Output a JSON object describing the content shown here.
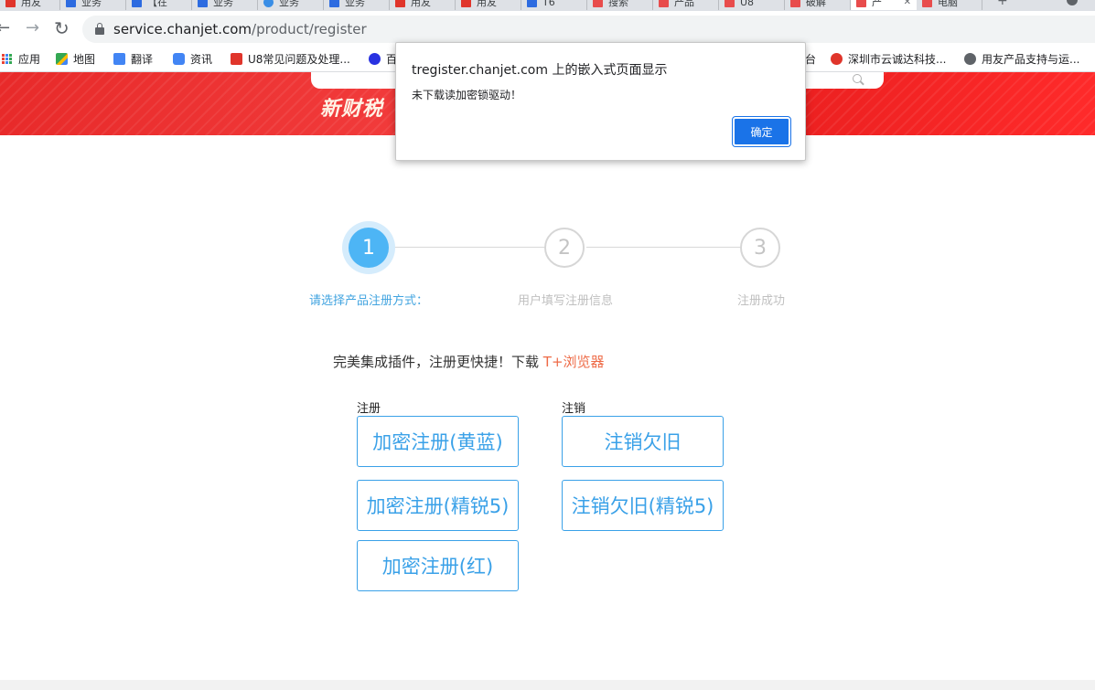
{
  "browser": {
    "tabs": [
      {
        "label": "用友",
        "icon_color": "#e0352b"
      },
      {
        "label": "业务",
        "icon_color": "#2d6be0"
      },
      {
        "label": "【在",
        "icon_color": "#2d6be0"
      },
      {
        "label": "业务",
        "icon_color": "#2d6be0"
      },
      {
        "label": "业务",
        "icon_color": "#3a8ee6"
      },
      {
        "label": "业务",
        "icon_color": "#2d6be0"
      },
      {
        "label": "用友",
        "icon_color": "#e0352b"
      },
      {
        "label": "用友",
        "icon_color": "#e0352b"
      },
      {
        "label": "T6",
        "icon_color": "#2d6be0"
      },
      {
        "label": "搜索",
        "icon_color": "#e84c4c"
      },
      {
        "label": "产品",
        "icon_color": "#e84c4c"
      },
      {
        "label": "U8",
        "icon_color": "#e84c4c"
      },
      {
        "label": "破解",
        "icon_color": "#e84c4c"
      },
      {
        "label": "产",
        "icon_color": "#e84c4c",
        "active": true,
        "close": "✕"
      },
      {
        "label": "电脑",
        "icon_color": "#e84c4c"
      }
    ],
    "new_tab_label": "+",
    "back_label": "←",
    "forward_label": "→",
    "reload_label": "↻",
    "url_host": "service.chanjet.com",
    "url_path": "/product/register",
    "bookmarks": [
      {
        "label": "应用",
        "icon": "apps-grid-icon",
        "icon_color": ""
      },
      {
        "label": "地图",
        "icon": "maps-icon",
        "icon_color": "#34a853"
      },
      {
        "label": "翻译",
        "icon": "translate-icon",
        "icon_color": "#4285f4"
      },
      {
        "label": "资讯",
        "icon": "news-icon",
        "icon_color": "#4285f4"
      },
      {
        "label": "U8常见问题及处理...",
        "icon": "u8-icon",
        "icon_color": "#e0352b"
      },
      {
        "label": "百",
        "icon": "baidu-icon",
        "icon_color": "#2932e1"
      },
      {
        "label": "台",
        "icon": "",
        "icon_color": ""
      },
      {
        "label": "深圳市云诚达科技...",
        "icon": "chanjet-icon",
        "icon_color": "#e0352b"
      },
      {
        "label": "用友产品支持与运...",
        "icon": "globe-icon",
        "icon_color": "#5f6368"
      }
    ]
  },
  "banner": {
    "title": "新财税"
  },
  "steps": [
    {
      "number": "1",
      "label": "请选择产品注册方式：",
      "active": true
    },
    {
      "number": "2",
      "label": "用户填写注册信息",
      "active": false
    },
    {
      "number": "3",
      "label": "注册成功",
      "active": false
    }
  ],
  "promo": {
    "text": "完美集成插件，注册更快捷！下载 ",
    "link": "T+浏览器"
  },
  "register": {
    "heading": "注册",
    "buttons": [
      "加密注册(黄蓝)",
      "加密注册(精锐5)",
      "加密注册(红)"
    ]
  },
  "unregister": {
    "heading": "注销",
    "buttons": [
      "注销欠旧",
      "注销欠旧(精锐5)"
    ]
  },
  "dialog": {
    "title": "tregister.chanjet.com 上的嵌入式页面显示",
    "message": "未下载读加密锁驱动！",
    "ok_label": "确定"
  },
  "colors": {
    "accent": "#3aa1e8",
    "active_step": "#4db5f5",
    "link": "#ee6b47",
    "dialog_button": "#1a73e8",
    "banner_red": "#e82a2a"
  }
}
